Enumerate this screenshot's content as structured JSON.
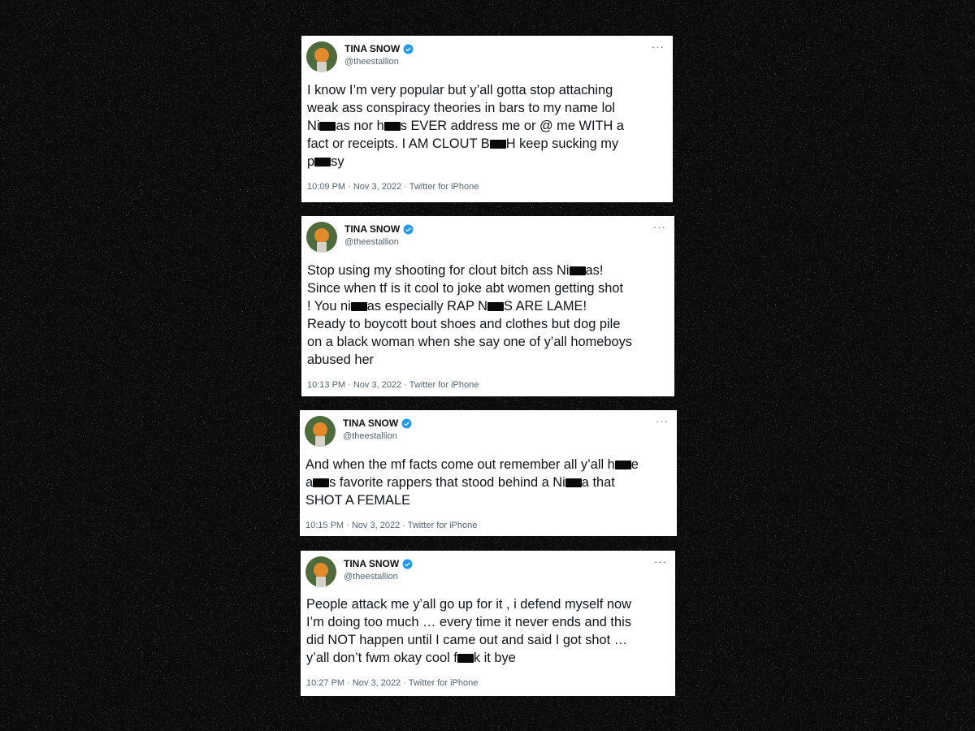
{
  "tweets": [
    {
      "name": "TINA SNOW",
      "handle": "@theestallion",
      "lines": [
        [
          "I know I’m very popular but y’all gotta stop attaching"
        ],
        [
          "weak ass conspiracy theories in bars to my name lol"
        ],
        [
          "Ni",
          "[R]",
          "as nor h",
          "[R]",
          "s EVER address me or @ me WITH a"
        ],
        [
          "fact or receipts. I AM CLOUT B",
          "[R]",
          "H keep sucking my"
        ],
        [
          "p",
          "[R]",
          "sy"
        ]
      ],
      "meta": "10:09 PM · Nov 3, 2022 · Twitter for iPhone"
    },
    {
      "name": "TINA SNOW",
      "handle": "@theestallion",
      "lines": [
        [
          "Stop using my shooting for clout bitch ass Ni",
          "[R]",
          "as!"
        ],
        [
          "Since when tf is it cool to joke abt women getting shot"
        ],
        [
          "! You ni",
          "[R]",
          "as especially RAP N",
          "[R]",
          "S ARE LAME!"
        ],
        [
          "Ready to boycott bout shoes and clothes but dog pile"
        ],
        [
          "on a black woman when she say one of y’all homeboys"
        ],
        [
          "abused her"
        ]
      ],
      "meta": "10:13 PM · Nov 3, 2022 · Twitter for iPhone"
    },
    {
      "name": "TINA SNOW",
      "handle": "@theestallion",
      "lines": [
        [
          "And when the mf facts come out remember all y’all h",
          "[R]",
          "e"
        ],
        [
          "a",
          "[R]",
          "s favorite rappers that stood behind a Ni",
          "[R]",
          "a that"
        ],
        [
          "SHOT A FEMALE"
        ]
      ],
      "meta": "10:15 PM · Nov 3, 2022 · Twitter for iPhone"
    },
    {
      "name": "TINA SNOW",
      "handle": "@theestallion",
      "lines": [
        [
          "People attack me y’all go up for it , i defend myself now"
        ],
        [
          "I’m doing too much … every time it never ends and this"
        ],
        [
          "did NOT happen until I came out and said I got shot …"
        ],
        [
          "y’all don’t fwm okay cool f",
          "[R]",
          "k it bye"
        ]
      ],
      "meta": "10:27 PM · Nov 3, 2022 · Twitter for iPhone"
    }
  ],
  "more_icon": "···",
  "colors": {
    "background": "#0b0b0b",
    "card": "#ffffff",
    "verified": "#1d9bf0",
    "muted": "#536471",
    "text": "#0f1419"
  }
}
